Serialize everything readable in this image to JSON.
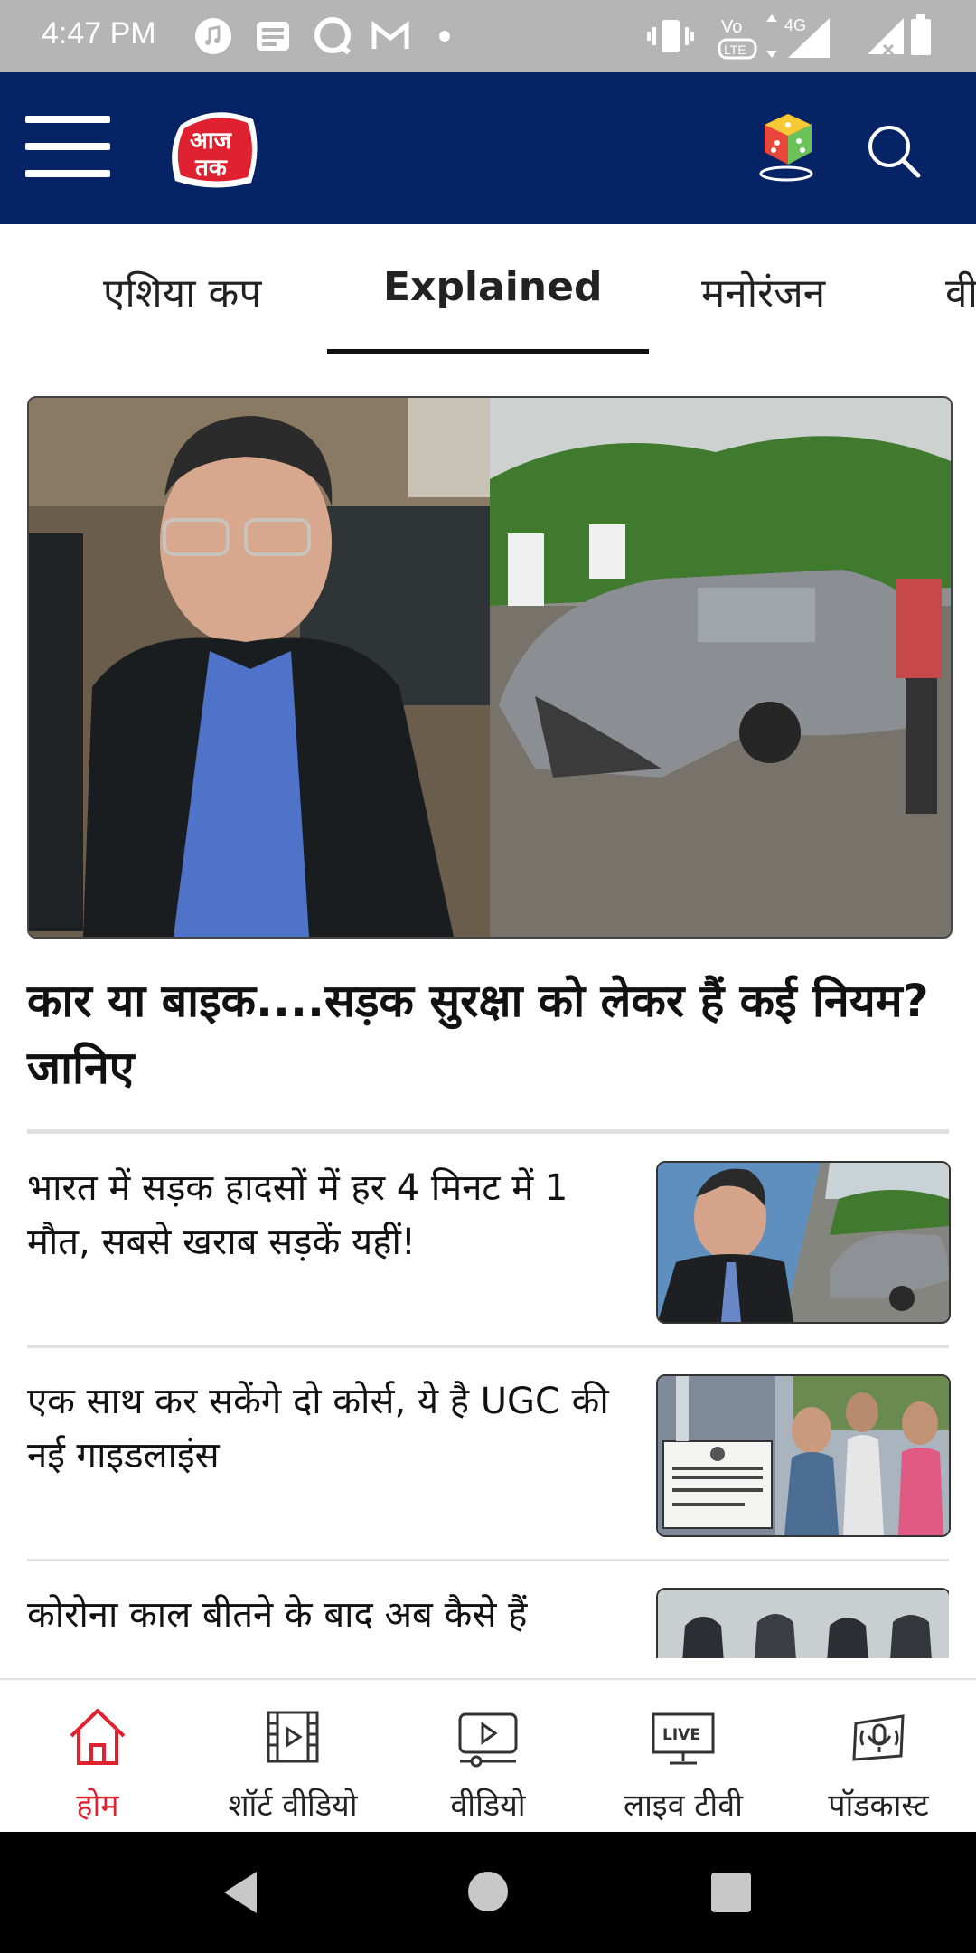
{
  "status_bar": {
    "time": "4:47 PM",
    "network": "4G",
    "volte": "Vo LTE"
  },
  "header": {
    "logo_text_top": "आज",
    "logo_text_bottom": "तक",
    "brand_color": "#062365",
    "logo_color": "#e0212f"
  },
  "tabs": [
    {
      "label": "एशिया कप"
    },
    {
      "label": "Explained",
      "active": true
    },
    {
      "label": "मनोरंजन"
    },
    {
      "label": "वी"
    }
  ],
  "hero": {
    "title": "कार या बाइक....सड़क सुरक्षा को लेकर हैं कई नियम? जानिए"
  },
  "articles": [
    {
      "title": "भारत में सड़क हादसों में हर 4 मिनट में 1 मौत, सबसे खराब सड़कें यहीं!"
    },
    {
      "title": "एक साथ कर सकेंगे दो कोर्स, ये है UGC की नई गाइडलाइंस",
      "thumb_sign": "विश्वविद्यालय अनुदान आयोग UNIVERSITY GRANTS COMMISSION BAHADURSHAH ZAFAR MARG NEW DELHI-110002"
    },
    {
      "title": "कोरोना काल बीतने के बाद अब कैसे हैं"
    }
  ],
  "bottom_nav": [
    {
      "label": "होम",
      "icon": "home-icon",
      "active": true
    },
    {
      "label": "शॉर्ट वीडियो",
      "icon": "film-icon"
    },
    {
      "label": "वीडियो",
      "icon": "video-icon"
    },
    {
      "label": "लाइव टीवी",
      "icon": "live-tv-icon",
      "badge": "LIVE"
    },
    {
      "label": "पॉडकास्ट",
      "icon": "podcast-icon"
    }
  ],
  "colors": {
    "accent": "#e0212f",
    "header": "#062365"
  }
}
